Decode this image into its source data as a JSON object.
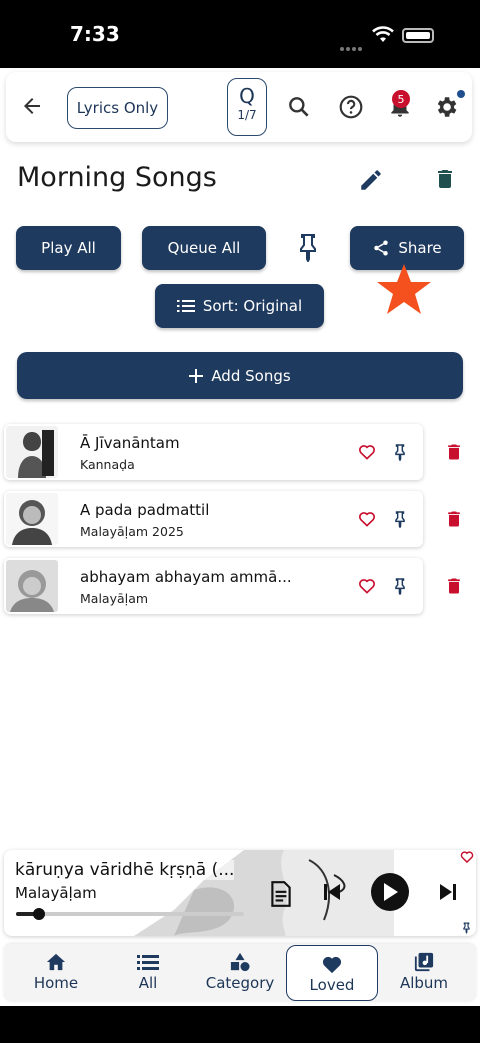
{
  "status": {
    "time": "7:33"
  },
  "header": {
    "lyrics_only_label": "Lyrics Only",
    "queue_letter": "Q",
    "queue_count": "1/7",
    "notification_count": "5"
  },
  "playlist": {
    "title": "Morning Songs",
    "play_all": "Play All",
    "queue_all": "Queue All",
    "share": "Share",
    "sort": "Sort: Original",
    "add_songs": "Add Songs"
  },
  "songs": [
    {
      "title": "Ā Jīvanāntam",
      "subtitle": "Kannaḍa"
    },
    {
      "title": "A pada padmattil",
      "subtitle": "Malayāḷam 2025"
    },
    {
      "title": "abhayam abhayam ammā...",
      "subtitle": "Malayāḷam"
    }
  ],
  "player": {
    "title": "kāruṇya vāridhē kṛṣṇā (...",
    "subtitle": "Malayāḷam",
    "progress": 0.1
  },
  "nav": {
    "home": "Home",
    "all": "All",
    "category": "Category",
    "loved": "Loved",
    "album": "Album"
  },
  "colors": {
    "primary": "#1f3a5f",
    "danger": "#c8102e",
    "accent_star": "#f4511e"
  }
}
